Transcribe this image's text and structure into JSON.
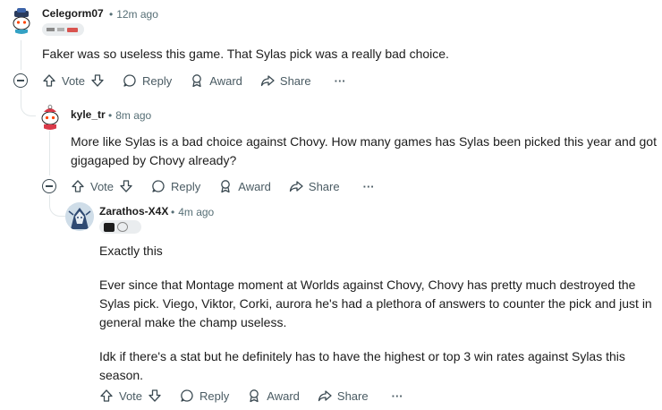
{
  "comments": [
    {
      "username": "Celegorm07",
      "time": "12m ago",
      "body": [
        "Faker was so useless this game. That Sylas pick was a really bad choice."
      ]
    },
    {
      "username": "kyle_tr",
      "time": "8m ago",
      "body": [
        "More like Sylas is a bad choice against Chovy. How many games has Sylas been picked this year and got gigagaped by Chovy already?"
      ]
    },
    {
      "username": "Zarathos-X4X",
      "time": "4m ago",
      "body": [
        "Exactly this",
        "Ever since that Montage moment at Worlds against Chovy, Chovy has pretty much destroyed the Sylas pick. Viego, Viktor, Corki, aurora he's had a plethora of answers to counter the pick and just in general make the champ useless.",
        "Idk if there's a stat but he definitely has to have the highest or top 3 win rates against Sylas this season."
      ]
    }
  ],
  "actions": {
    "vote": "Vote",
    "reply": "Reply",
    "award": "Award",
    "share": "Share",
    "more": "···"
  },
  "colors": {
    "text": "#1c1c1c",
    "meta": "#576f76",
    "action": "#4a5b63",
    "thread_line": "#e2e7e9",
    "flair_bg": "#eaedef"
  }
}
